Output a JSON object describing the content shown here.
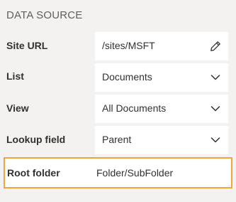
{
  "section": {
    "title": "DATA SOURCE"
  },
  "fields": {
    "site_url": {
      "label": "Site URL",
      "value": "/sites/MSFT",
      "icon": "pencil-icon"
    },
    "list": {
      "label": "List",
      "value": "Documents",
      "icon": "chevron-down-icon"
    },
    "view": {
      "label": "View",
      "value": "All Documents",
      "icon": "chevron-down-icon"
    },
    "lookup_field": {
      "label": "Lookup field",
      "value": "Parent",
      "icon": "chevron-down-icon"
    },
    "root_folder": {
      "label": "Root folder",
      "value": "Folder/SubFolder"
    }
  },
  "colors": {
    "panel_background": "#f3f2f1",
    "field_background": "#ffffff",
    "highlight_border": "#f2a33a",
    "label_text": "#323130",
    "section_title_text": "#605e5c"
  }
}
